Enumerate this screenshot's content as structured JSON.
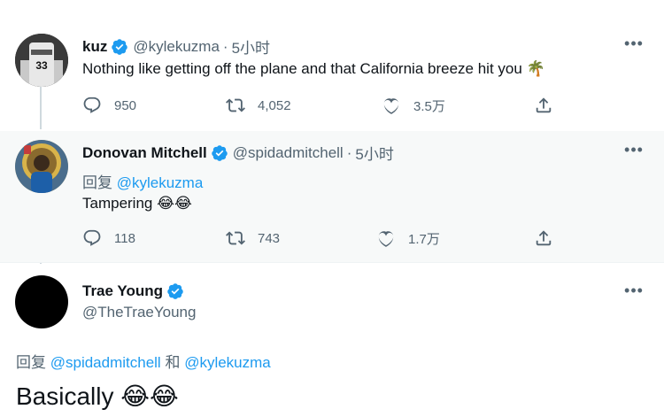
{
  "tweets": [
    {
      "name": "kuz",
      "handle": "@kylekuzma",
      "time": "5小时",
      "text": "Nothing like getting off the plane and that California breeze hit you",
      "emoji": "🌴",
      "replies": "950",
      "retweets": "4,052",
      "likes": "3.5万"
    },
    {
      "name": "Donovan Mitchell",
      "handle": "@spidadmitchell",
      "time": "5小时",
      "reply_prefix": "回复",
      "reply_mention": "@kylekuzma",
      "text": "Tampering",
      "emoji": "😂😂",
      "replies": "118",
      "retweets": "743",
      "likes": "1.7万"
    },
    {
      "name": "Trae Young",
      "handle": "@TheTraeYoung",
      "reply_prefix": "回复",
      "reply_mention_1": "@spidadmitchell",
      "reply_joiner": "和",
      "reply_mention_2": "@kylekuzma",
      "text": "Basically",
      "emoji": "😂😂"
    }
  ],
  "icons": {
    "more": "more-icon",
    "reply": "reply-icon",
    "retweet": "retweet-icon",
    "like": "heart-icon",
    "share": "share-icon",
    "verified": "verified-badge-icon"
  },
  "colors": {
    "link": "#1d9bf0",
    "secondary": "#536471",
    "verified": "#1d9bf0"
  }
}
